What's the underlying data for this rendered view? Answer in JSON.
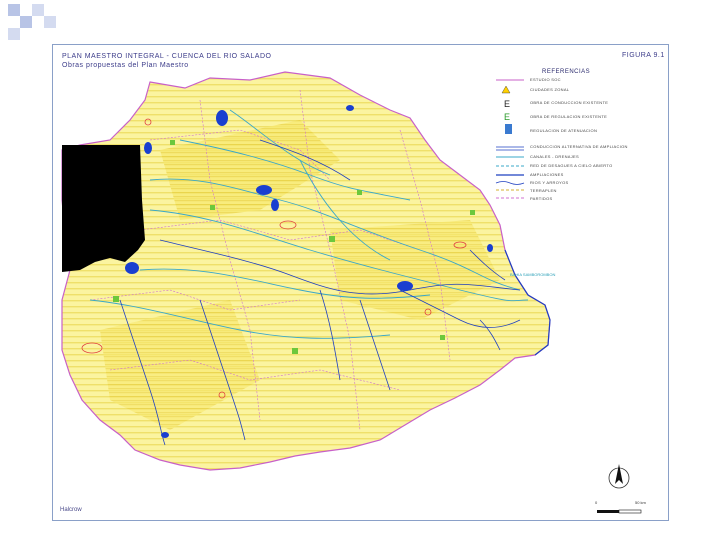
{
  "map": {
    "title": "PLAN MAESTRO INTEGRAL - CUENCA DEL RIO SALADO",
    "subtitle": "Obras propuestas del Plan Maestro",
    "figure_label": "FIGURA 9.1",
    "footer": "Halcrow",
    "outlet_label": "BAHIA SAMBOROMBON",
    "scale": {
      "start": "0",
      "end": "50 km"
    }
  },
  "legend": {
    "title": "REFERENCIAS",
    "items": [
      {
        "icon": "generic-line",
        "label": "ESTUDIO SOC"
      },
      {
        "icon": "warning-triangle-icon",
        "label": "CIUDADES ZONAL"
      },
      {
        "icon": "letter-e-icon",
        "label": "OBRA DE CONDUCCION EXISTENTE"
      },
      {
        "icon": "letter-e-green-icon",
        "label": "OBRA DE REGULACION EXISTENTE"
      },
      {
        "icon": "hatched-pattern-icon",
        "label": "REGULACION DE ATENUACION"
      },
      {
        "icon": "double-line",
        "label": "CONDUCCION ALTERNATIVA DE AMPLIACION"
      },
      {
        "icon": "blue-line",
        "label": "CANALES - DRENAJES"
      },
      {
        "icon": "dashed-blue-line",
        "label": "RED DE DESAGUES A CIELO ABIERTO"
      },
      {
        "icon": "navy-line",
        "label": "AMPLIACIONES"
      },
      {
        "icon": "wavy-line",
        "label": "RIOS Y ARROYOS"
      },
      {
        "icon": "yellow-dashed-line",
        "label": "TERRAPLEN"
      },
      {
        "icon": "pink-dashed-line",
        "label": "PARTIDOS"
      }
    ]
  },
  "colors": {
    "accent": "#3c3c8a",
    "land": "#fbf4a0",
    "stripe": "#f0e060",
    "boundary": "#c860c8",
    "water": "#1a3fd0",
    "channel": "#3aa8c8",
    "green_marker": "#6cc83c",
    "city": "#e04040",
    "mask": "#000000"
  }
}
